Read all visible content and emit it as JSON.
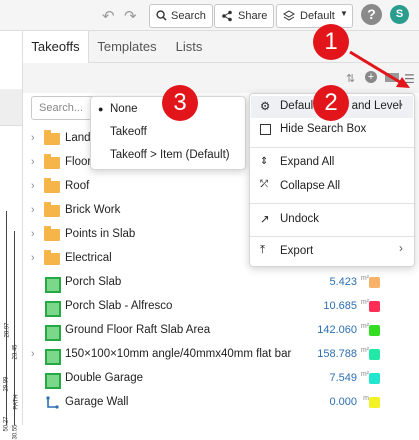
{
  "toolbar": {
    "undo": "↶",
    "redo": "↷",
    "search_label": "Search",
    "share_label": "Share",
    "default_label": "Default",
    "help": "?",
    "avatar_initial": "S"
  },
  "tabs": [
    "Takeoffs",
    "Templates",
    "Lists"
  ],
  "search": {
    "placeholder": "Search..."
  },
  "drawing": {
    "ticks": [
      "28.97",
      "23.45",
      "29.99",
      "PATH",
      "50.27",
      "30.55"
    ]
  },
  "list": [
    {
      "type": "folder",
      "label": "Land",
      "expand": true
    },
    {
      "type": "folder",
      "label": "Floor",
      "expand": true
    },
    {
      "type": "folder",
      "label": "Roof",
      "expand": true
    },
    {
      "type": "folder",
      "label": "Brick Work",
      "expand": true
    },
    {
      "type": "folder",
      "label": "Points in Slab",
      "expand": true
    },
    {
      "type": "folder",
      "label": "Electrical",
      "expand": true
    },
    {
      "type": "area",
      "label": "Porch Slab",
      "value": "5.423",
      "unit": "m²",
      "color": "#f7b267"
    },
    {
      "type": "area",
      "label": "Porch Slab - Alfresco",
      "value": "10.685",
      "unit": "m²",
      "color": "#ff2d55"
    },
    {
      "type": "area",
      "label": "Ground Floor Raft Slab Area",
      "value": "142.060",
      "unit": "m²",
      "color": "#33dd22"
    },
    {
      "type": "area",
      "label": "150×100×10mm angle/40mmx40mm flat bar",
      "value": "158.788",
      "unit": "m²",
      "color": "#22e8a8",
      "expand": true
    },
    {
      "type": "area",
      "label": "Double Garage",
      "value": "7.549",
      "unit": "m²",
      "color": "#22e6d0"
    },
    {
      "type": "line",
      "label": "Garage Wall",
      "value": "0.000",
      "unit": "m",
      "color": "#f2f227"
    }
  ],
  "level_menu": {
    "items": [
      "None",
      "Takeoff",
      "Takeoff > Item (Default)"
    ],
    "selected": "None"
  },
  "options_menu": {
    "default_level": "Default Show and Level",
    "hide_search": "Hide Search Box",
    "expand_all": "Expand All",
    "collapse_all": "Collapse All",
    "undock": "Undock",
    "export": "Export"
  },
  "callouts": [
    "1",
    "2",
    "3"
  ],
  "callout_color": "#e2151b"
}
